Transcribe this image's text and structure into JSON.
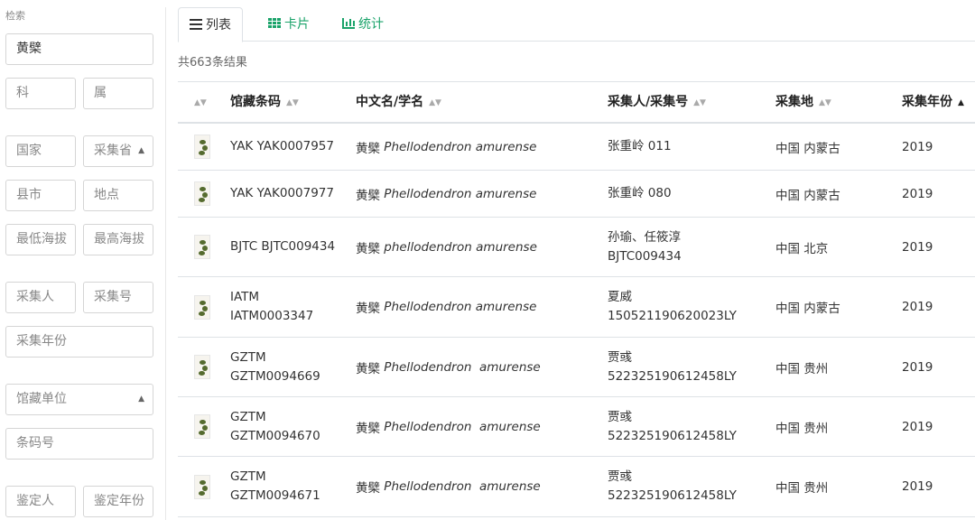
{
  "sidebar": {
    "title": "检索",
    "fields": [
      {
        "key": "keyword",
        "value": "黄檗",
        "placeholder": ""
      },
      {
        "key": "family",
        "placeholder": "科"
      },
      {
        "key": "genus",
        "placeholder": "属"
      },
      {
        "key": "country",
        "placeholder": "国家"
      },
      {
        "key": "province",
        "placeholder": "采集省"
      },
      {
        "key": "county",
        "placeholder": "县市"
      },
      {
        "key": "locality",
        "placeholder": "地点"
      },
      {
        "key": "min_alt",
        "placeholder": "最低海拔"
      },
      {
        "key": "max_alt",
        "placeholder": "最高海拔"
      },
      {
        "key": "collector",
        "placeholder": "采集人"
      },
      {
        "key": "coll_no",
        "placeholder": "采集号"
      },
      {
        "key": "coll_year",
        "placeholder": "采集年份"
      },
      {
        "key": "institution",
        "placeholder": "馆藏单位"
      },
      {
        "key": "barcode",
        "placeholder": "条码号"
      },
      {
        "key": "identifier",
        "placeholder": "鉴定人"
      },
      {
        "key": "ident_year",
        "placeholder": "鉴定年份"
      }
    ]
  },
  "tabs": [
    {
      "label": "列表",
      "icon": "list-icon",
      "active": true
    },
    {
      "label": "卡片",
      "icon": "grid-icon",
      "active": false
    },
    {
      "label": "统计",
      "icon": "bar-chart-icon",
      "active": false
    }
  ],
  "result_count": "共663条结果",
  "table": {
    "headers": [
      "馆藏条码",
      "中文名/学名",
      "采集人/采集号",
      "采集地",
      "采集年份"
    ],
    "rows": [
      {
        "barcode": [
          "YAK YAK0007957"
        ],
        "cn": "黄檗",
        "sci": "Phellodendron amurense",
        "collector": [
          "张重岭 011"
        ],
        "place": "中国 内蒙古",
        "year": "2019"
      },
      {
        "barcode": [
          "YAK YAK0007977"
        ],
        "cn": "黄檗",
        "sci": "Phellodendron amurense",
        "collector": [
          "张重岭 080"
        ],
        "place": "中国 内蒙古",
        "year": "2019"
      },
      {
        "barcode": [
          "BJTC BJTC009434"
        ],
        "cn": "黄檗",
        "sci": "phellodendron amurense",
        "collector": [
          "孙瑜、任筱淳",
          "BJTC009434"
        ],
        "place": "中国 北京",
        "year": "2019"
      },
      {
        "barcode": [
          "IATM",
          "IATM0003347"
        ],
        "cn": "黄檗",
        "sci": "Phellodendron amurense",
        "collector": [
          "夏威",
          "150521190620023LY"
        ],
        "place": "中国 内蒙古",
        "year": "2019"
      },
      {
        "barcode": [
          "GZTM",
          "GZTM0094669"
        ],
        "cn": "黄檗",
        "sci": "Phellodendron  amurense",
        "collector": [
          "贾彧",
          "522325190612458LY"
        ],
        "place": "中国 贵州",
        "year": "2019"
      },
      {
        "barcode": [
          "GZTM",
          "GZTM0094670"
        ],
        "cn": "黄檗",
        "sci": "Phellodendron  amurense",
        "collector": [
          "贾彧",
          "522325190612458LY"
        ],
        "place": "中国 贵州",
        "year": "2019"
      },
      {
        "barcode": [
          "GZTM",
          "GZTM0094671"
        ],
        "cn": "黄檗",
        "sci": "Phellodendron  amurense",
        "collector": [
          "贾彧",
          "522325190612458LY"
        ],
        "place": "中国 贵州",
        "year": "2019"
      }
    ]
  },
  "colors": {
    "accent": "#1aa36a",
    "border": "#dee2e6"
  }
}
